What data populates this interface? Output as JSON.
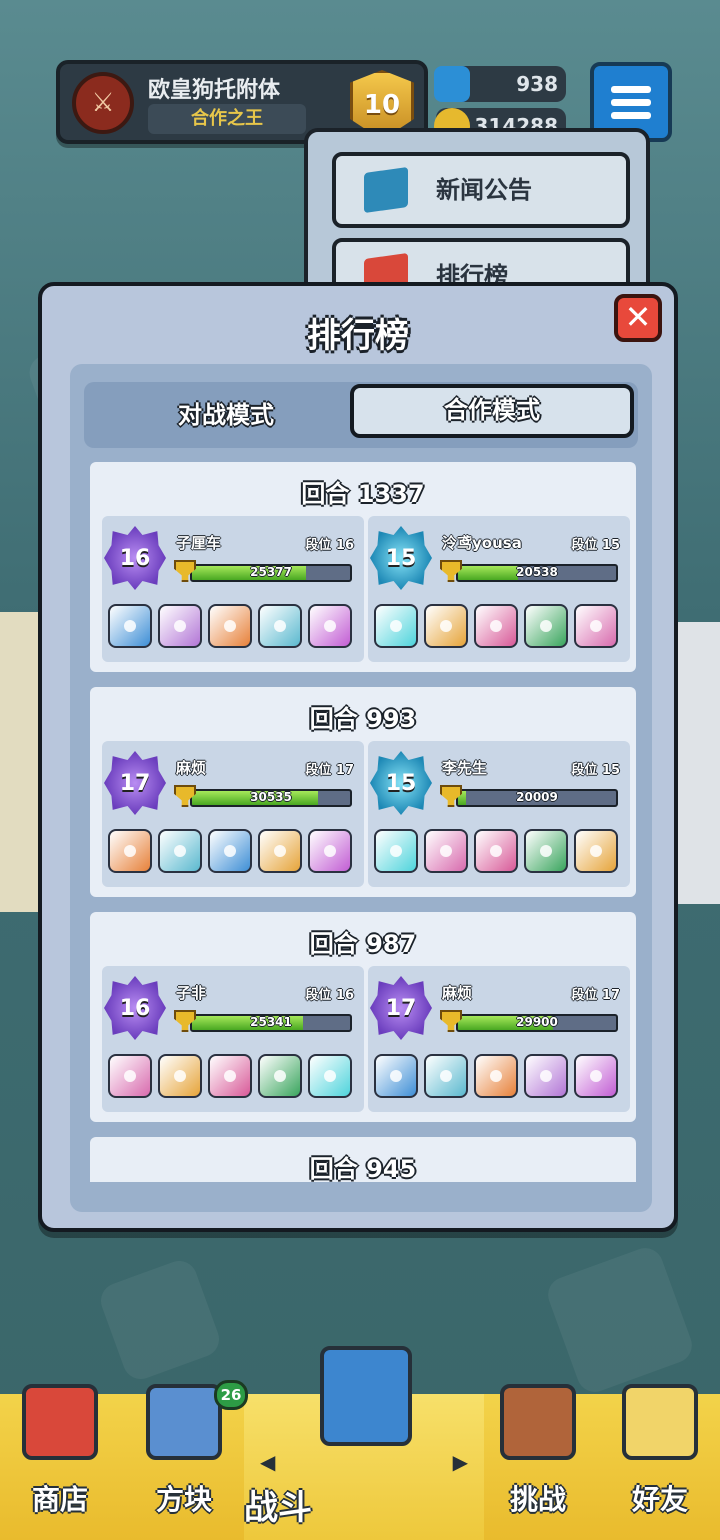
{
  "profile": {
    "name": "欧皇狗托附体",
    "title": "合作之王",
    "rank_level": "10",
    "gems": "938",
    "gold": "314288"
  },
  "menu": {
    "items": [
      {
        "label": "新闻公告",
        "icon": "news-monitor-icon"
      },
      {
        "label": "排行榜",
        "icon": "leaderboard-icon"
      }
    ]
  },
  "leaderboard": {
    "title": "排行榜",
    "close_icon": "close-icon",
    "tabs": [
      {
        "label": "对战模式",
        "selected": false
      },
      {
        "label": "合作模式",
        "selected": true
      }
    ],
    "entries": [
      {
        "round_label": "回合",
        "round": "1337",
        "players": [
          {
            "name": "子厘车",
            "tier_label": "段位",
            "tier": "16",
            "emblem": "16",
            "emblem_color": "#7a4dd1",
            "score": "25377",
            "progress": 0.72,
            "dice": [
              "#3f8fd6",
              "#b276d6",
              "#e7813a",
              "#5bb9cf",
              "#c25ed4"
            ]
          },
          {
            "name": "泠鸢yousa",
            "tier_label": "段位",
            "tier": "15",
            "emblem": "15",
            "emblem_color": "#2a9cc7",
            "score": "20538",
            "progress": 0.38,
            "dice": [
              "#4fd4dc",
              "#e6a43a",
              "#d85a98",
              "#3aa55e",
              "#d86bae"
            ]
          }
        ]
      },
      {
        "round_label": "回合",
        "round": "993",
        "players": [
          {
            "name": "麻烦",
            "tier_label": "段位",
            "tier": "17",
            "emblem": "17",
            "emblem_color": "#7a4dd1",
            "score": "30535",
            "progress": 0.8,
            "dice": [
              "#e7813a",
              "#5bb9cf",
              "#3f8fd6",
              "#e6a43a",
              "#c25ed4"
            ]
          },
          {
            "name": "李先生",
            "tier_label": "段位",
            "tier": "15",
            "emblem": "15",
            "emblem_color": "#2a9cc7",
            "score": "20009",
            "progress": 0.05,
            "dice": [
              "#4fd4dc",
              "#d86bae",
              "#d85a98",
              "#3aa55e",
              "#e6a43a"
            ]
          }
        ]
      },
      {
        "round_label": "回合",
        "round": "987",
        "players": [
          {
            "name": "子非",
            "tier_label": "段位",
            "tier": "16",
            "emblem": "16",
            "emblem_color": "#7a4dd1",
            "score": "25341",
            "progress": 0.7,
            "dice": [
              "#d86bae",
              "#e6a43a",
              "#d85a98",
              "#3aa55e",
              "#4fd4dc"
            ]
          },
          {
            "name": "麻烦",
            "tier_label": "段位",
            "tier": "17",
            "emblem": "17",
            "emblem_color": "#7a4dd1",
            "score": "29900",
            "progress": 0.6,
            "dice": [
              "#3f8fd6",
              "#5bb9cf",
              "#e7813a",
              "#b276d6",
              "#c25ed4"
            ]
          }
        ]
      },
      {
        "round_label": "回合",
        "round": "945",
        "players": []
      }
    ]
  },
  "bottom_nav": {
    "items": [
      {
        "label": "商店",
        "icon": "shop-icon"
      },
      {
        "label": "方块",
        "icon": "dice-box-icon",
        "badge": "26"
      },
      {
        "label": "战斗",
        "icon": "battle-card-icon",
        "active": true
      },
      {
        "label": "挑战",
        "icon": "challenge-icon"
      },
      {
        "label": "好友",
        "icon": "friends-icon"
      }
    ]
  }
}
